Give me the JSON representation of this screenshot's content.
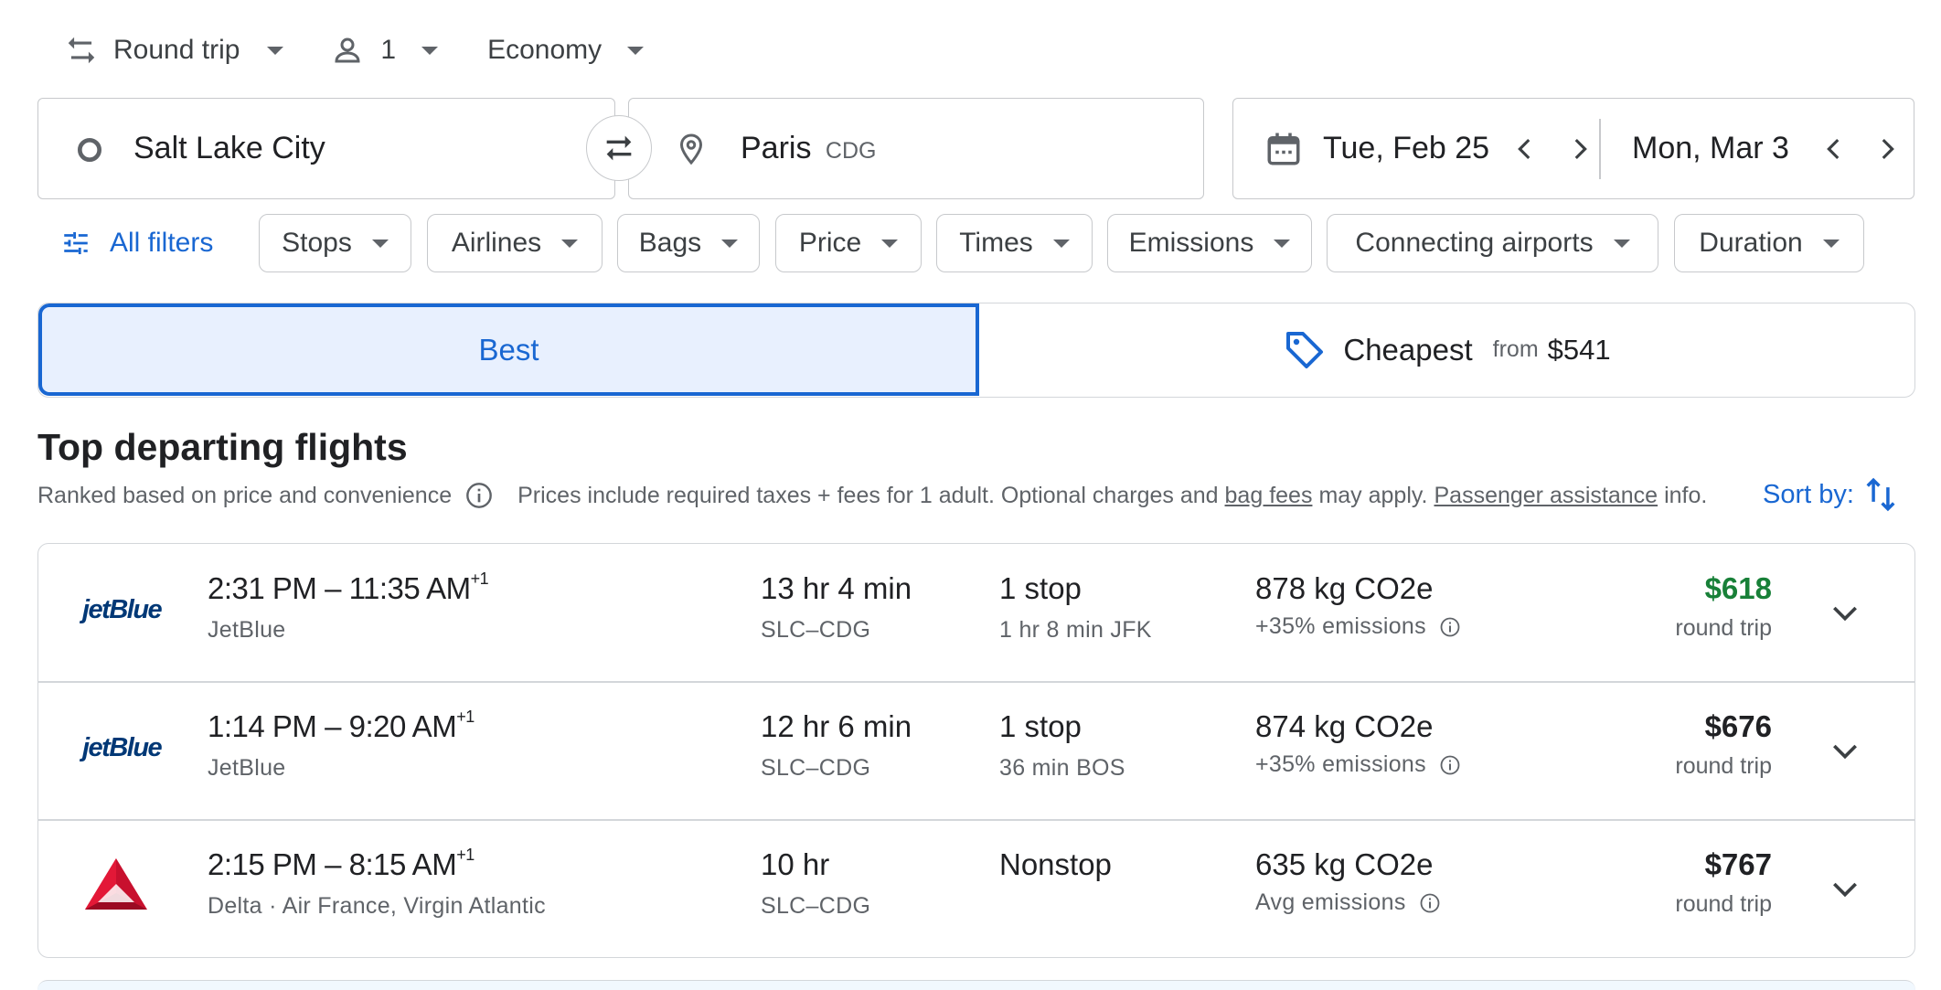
{
  "trip": {
    "type": "Round trip",
    "passengers": "1",
    "cabin": "Economy"
  },
  "search": {
    "origin": "Salt Lake City",
    "destination": "Paris",
    "destination_code": "CDG",
    "depart_date": "Tue, Feb 25",
    "return_date": "Mon, Mar 3"
  },
  "filters": {
    "all": "All filters",
    "chips": [
      "Stops",
      "Airlines",
      "Bags",
      "Price",
      "Times",
      "Emissions",
      "Connecting airports",
      "Duration"
    ]
  },
  "tabs": {
    "best": "Best",
    "cheapest": "Cheapest",
    "cheapest_from": "from",
    "cheapest_price": "$541"
  },
  "results": {
    "heading": "Top departing flights",
    "ranked": "Ranked based on price and convenience",
    "prices_note_1": "Prices include required taxes + fees for 1 adult. Optional charges and",
    "bag_fees": "bag fees",
    "prices_note_2": "may apply.",
    "passenger_assistance": "Passenger assistance",
    "prices_note_3": "info.",
    "sort_by": "Sort by:"
  },
  "flights": [
    {
      "airline_logo": "jetBlue",
      "depart": "2:31 PM",
      "arrive": "11:35 AM",
      "day_offset": "+1",
      "airline": "JetBlue",
      "duration": "13 hr 4 min",
      "route": "SLC–CDG",
      "stops": "1 stop",
      "layover": "1 hr 8 min JFK",
      "co2": "878 kg CO2e",
      "emissions": "+35% emissions",
      "price": "$618",
      "price_color": "#188038",
      "price_type": "round trip"
    },
    {
      "airline_logo": "jetBlue",
      "depart": "1:14 PM",
      "arrive": "9:20 AM",
      "day_offset": "+1",
      "airline": "JetBlue",
      "duration": "12 hr 6 min",
      "route": "SLC–CDG",
      "stops": "1 stop",
      "layover": "36 min BOS",
      "co2": "874 kg CO2e",
      "emissions": "+35% emissions",
      "price": "$676",
      "price_color": "#202124",
      "price_type": "round trip"
    },
    {
      "airline_logo": "delta",
      "depart": "2:15 PM",
      "arrive": "8:15 AM",
      "day_offset": "+1",
      "airline": "Delta · Air France, Virgin Atlantic",
      "duration": "10 hr",
      "route": "SLC–CDG",
      "stops": "Nonstop",
      "layover": "",
      "co2": "635 kg CO2e",
      "emissions": "Avg emissions",
      "price": "$767",
      "price_color": "#202124",
      "price_type": "round trip"
    }
  ],
  "colors": {
    "accent": "#1967d2",
    "green_price": "#188038",
    "jetblue": "#003876",
    "delta_red": "#c8102e"
  }
}
